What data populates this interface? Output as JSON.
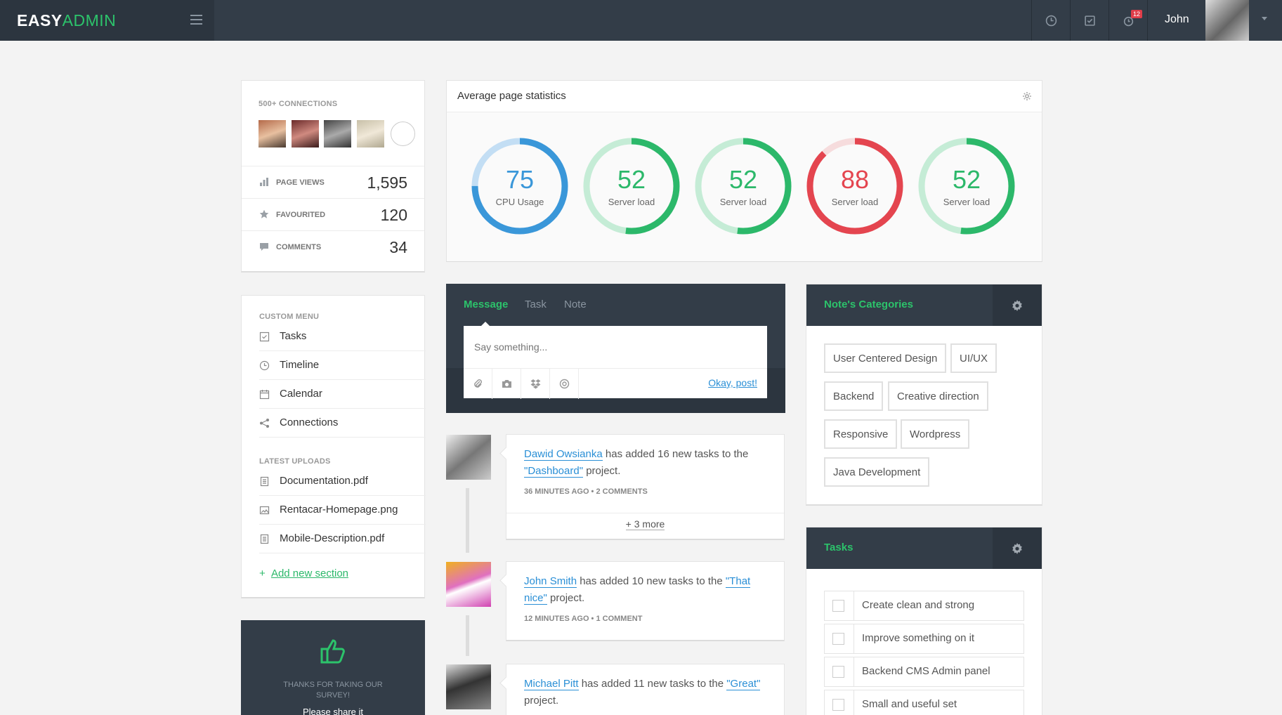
{
  "app": {
    "logo_bold": "EASY",
    "logo_light": "ADMIN"
  },
  "topbar": {
    "user_name": "John",
    "notification_count": "12"
  },
  "connections": {
    "label": "500+ CONNECTIONS",
    "stats": [
      {
        "icon": "bar-chart-icon",
        "label": "PAGE VIEWS",
        "value": "1,595"
      },
      {
        "icon": "star-icon",
        "label": "FAVOURITED",
        "value": "120"
      },
      {
        "icon": "comment-icon",
        "label": "COMMENTS",
        "value": "34"
      }
    ]
  },
  "menu": {
    "custom_label": "CUSTOM MENU",
    "items": [
      {
        "icon": "checkbox-icon",
        "label": "Tasks"
      },
      {
        "icon": "clock-icon",
        "label": "Timeline"
      },
      {
        "icon": "calendar-icon",
        "label": "Calendar"
      },
      {
        "icon": "share-icon",
        "label": "Connections"
      }
    ],
    "uploads_label": "LATEST UPLOADS",
    "uploads": [
      {
        "icon": "document-icon",
        "label": "Documentation.pdf"
      },
      {
        "icon": "image-icon",
        "label": "Rentacar-Homepage.png"
      },
      {
        "icon": "document-icon",
        "label": "Mobile-Description.pdf"
      }
    ],
    "add_section": "Add new section",
    "add_prefix": "+"
  },
  "survey": {
    "text_line1": "THANKS FOR TAKING OUR",
    "text_line2": "SURVEY!",
    "share": "Please share it"
  },
  "stats": {
    "title": "Average page statistics",
    "gauges": [
      {
        "value": "75",
        "label": "CPU Usage",
        "fraction": 0.75,
        "color": "#3a97d9",
        "track": "#c3def4"
      },
      {
        "value": "52",
        "label": "Server load",
        "fraction": 0.52,
        "color": "#2cb86a",
        "track": "#c5ecd6"
      },
      {
        "value": "52",
        "label": "Server load",
        "fraction": 0.52,
        "color": "#2cb86a",
        "track": "#c5ecd6"
      },
      {
        "value": "88",
        "label": "Server load",
        "fraction": 0.88,
        "color": "#e4454f",
        "track": "#f6dcdd"
      },
      {
        "value": "52",
        "label": "Server load",
        "fraction": 0.52,
        "color": "#2cb86a",
        "track": "#c5ecd6"
      }
    ]
  },
  "message": {
    "tabs": [
      "Message",
      "Task",
      "Note"
    ],
    "placeholder": "Say something...",
    "post": "Okay, post!"
  },
  "activity": [
    {
      "user": "Dawid Owsianka",
      "mid": " has added 16 new tasks to the ",
      "project": "\"Dashboard\"",
      "end": " project.",
      "meta": "36 MINUTES AGO • 2 COMMENTS",
      "more": "+ 3 more"
    },
    {
      "user": "John Smith",
      "mid": " has added 10 new tasks to the ",
      "project": "\"That nice\"",
      "end": " project.",
      "meta": "12 MINUTES AGO • 1 COMMENT"
    },
    {
      "user": "Michael Pitt",
      "mid": " has added 11 new tasks to the ",
      "project": "\"Great\"",
      "end": " project."
    }
  ],
  "notes": {
    "title": "Note's Categories",
    "tags": [
      "User Centered Design",
      "UI/UX",
      "Backend",
      "Creative direction",
      "Responsive",
      "Wordpress",
      "Java Development"
    ]
  },
  "tasks": {
    "title": "Tasks",
    "items": [
      "Create clean and strong",
      "Improve something on it",
      "Backend CMS Admin panel",
      "Small and useful set"
    ]
  },
  "colors": {
    "accent": "#2cc36b",
    "dark": "#333d48",
    "link": "#2a8fd6"
  }
}
